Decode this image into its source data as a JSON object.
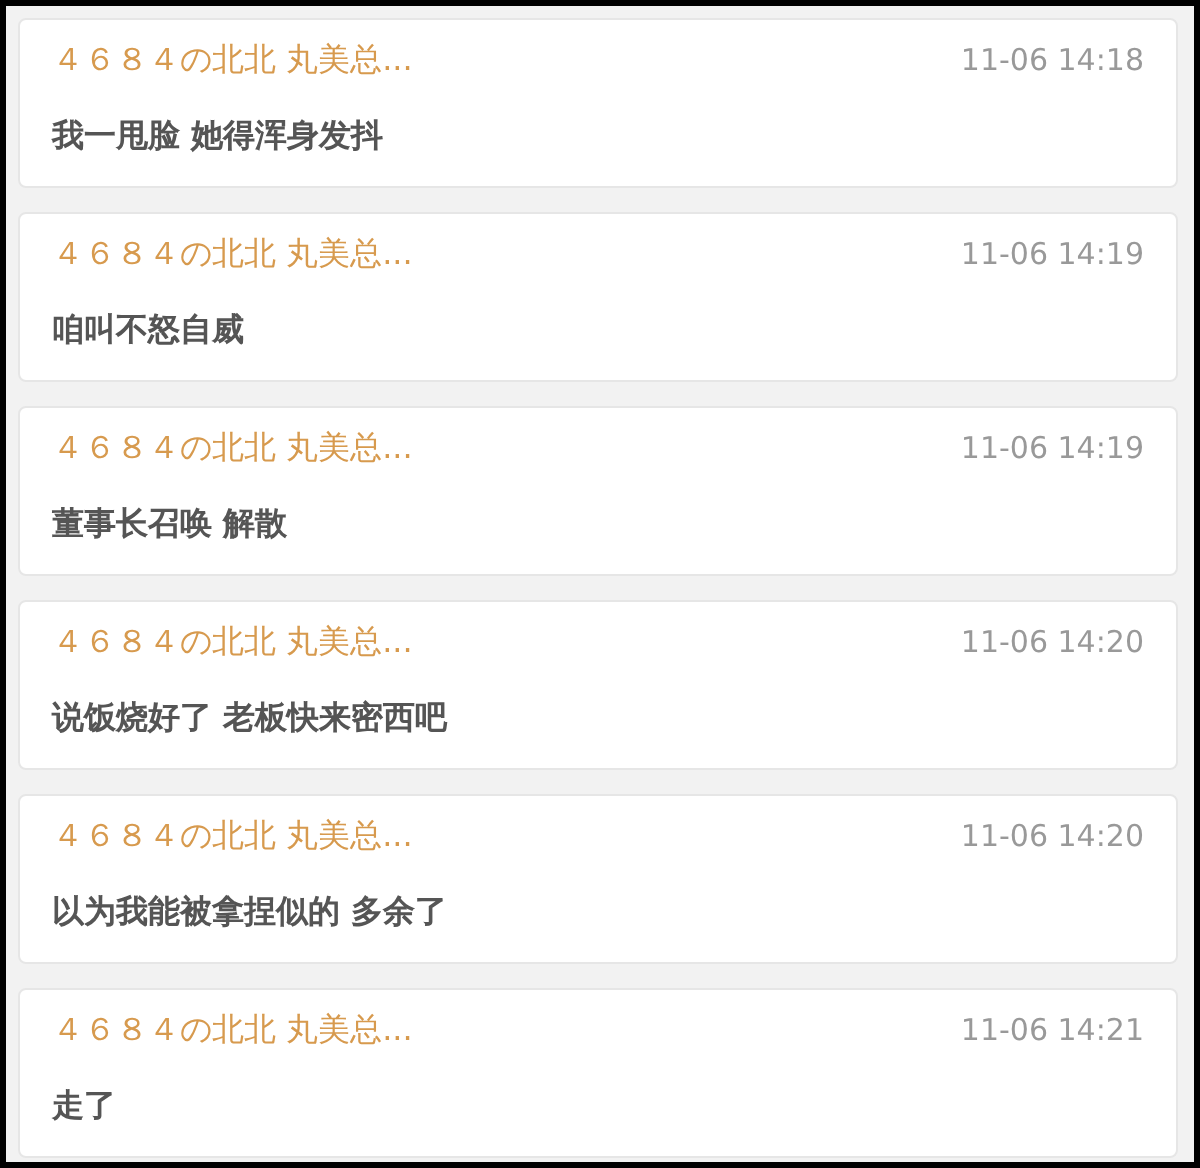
{
  "messages": [
    {
      "sender": "４６８４の北北 丸美总...",
      "time": "11-06 14:18",
      "text": "我一甩脸 她得浑身发抖"
    },
    {
      "sender": "４６８４の北北 丸美总...",
      "time": "11-06 14:19",
      "text": "咱叫不怒自威"
    },
    {
      "sender": "４６８４の北北 丸美总...",
      "time": "11-06 14:19",
      "text": "董事长召唤 解散"
    },
    {
      "sender": "４６８４の北北 丸美总...",
      "time": "11-06 14:20",
      "text": "说饭烧好了 老板快来密西吧"
    },
    {
      "sender": "４６８４の北北 丸美总...",
      "time": "11-06 14:20",
      "text": "以为我能被拿捏似的 多余了"
    },
    {
      "sender": "４６８４の北北 丸美总...",
      "time": "11-06 14:21",
      "text": "走了"
    }
  ]
}
